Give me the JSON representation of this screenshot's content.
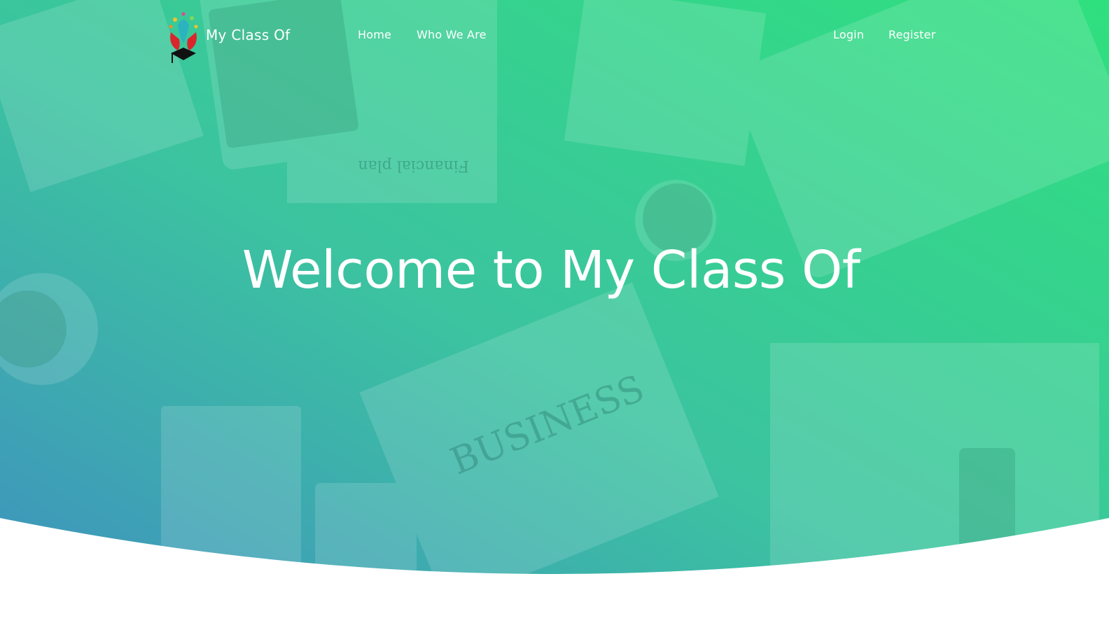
{
  "brand": {
    "name": "My Class Of",
    "logo_icon": "graduation-hands-logo"
  },
  "nav": {
    "left": [
      {
        "label": "Home"
      },
      {
        "label": "Who We Are"
      }
    ],
    "right": [
      {
        "label": "Login"
      },
      {
        "label": "Register"
      }
    ]
  },
  "hero": {
    "title": "Welcome to My Class Of",
    "background": "desk-workspace-photo",
    "gradient_colors": [
      "#3f8fc0",
      "#3cc3a0",
      "#2fe07e"
    ]
  }
}
